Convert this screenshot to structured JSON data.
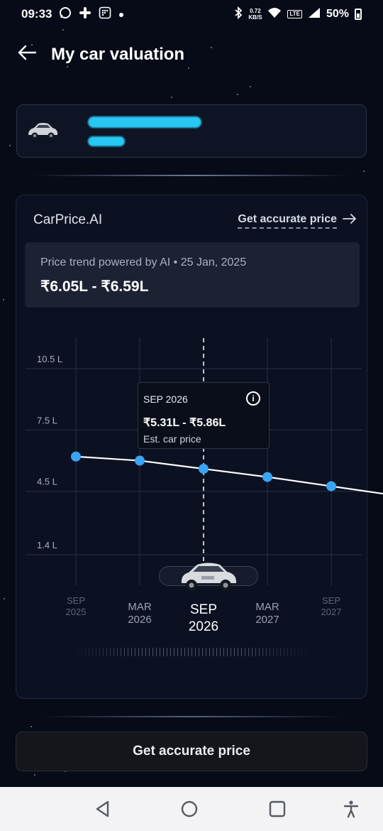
{
  "status_bar": {
    "time": "09:33",
    "notification_icons": [
      "whatsapp-icon",
      "slack-icon",
      "app-icon",
      "dot-icon"
    ],
    "network_speed": "0.72",
    "network_speed_unit": "KB/S",
    "network_badge": "LTE",
    "battery": "50%"
  },
  "header": {
    "title": "My car valuation"
  },
  "panel": {
    "brand": "CarPrice.AI",
    "accurate_link": "Get accurate price",
    "trend_subtitle": "Price trend powered by AI • 25 Jan, 2025",
    "trend_range": "₹6.05L - ₹6.59L"
  },
  "tooltip": {
    "date": "SEP 2026",
    "range": "₹5.31L - ₹5.86L",
    "label": "Est. car price"
  },
  "chart_data": {
    "type": "line",
    "x": [
      "SEP 2025",
      "MAR 2026",
      "SEP 2026",
      "MAR 2027",
      "SEP 2027"
    ],
    "values": [
      6.2,
      6.0,
      5.6,
      5.2,
      4.75
    ],
    "y_ticks": [
      "10.5 L",
      "7.5 L",
      "4.5 L",
      "1.4 L"
    ],
    "y_tick_values": [
      10.5,
      7.5,
      4.5,
      1.4
    ],
    "ylim": [
      1.4,
      10.5
    ],
    "x_tick_labels": [
      {
        "month": "SEP",
        "year": "2025"
      },
      {
        "month": "MAR",
        "year": "2026"
      },
      {
        "month": "SEP",
        "year": "2026"
      },
      {
        "month": "MAR",
        "year": "2027"
      },
      {
        "month": "SEP",
        "year": "2027"
      }
    ],
    "selected_index": 2,
    "line_color": "#ffffff",
    "point_color": "#3aa4f5",
    "grid": true
  },
  "cta": {
    "label": "Get accurate price"
  },
  "colors": {
    "background": "#070b18",
    "panel": "#0c1122",
    "accent_blue": "#3aa4f5",
    "redaction": "#28c8f4"
  }
}
